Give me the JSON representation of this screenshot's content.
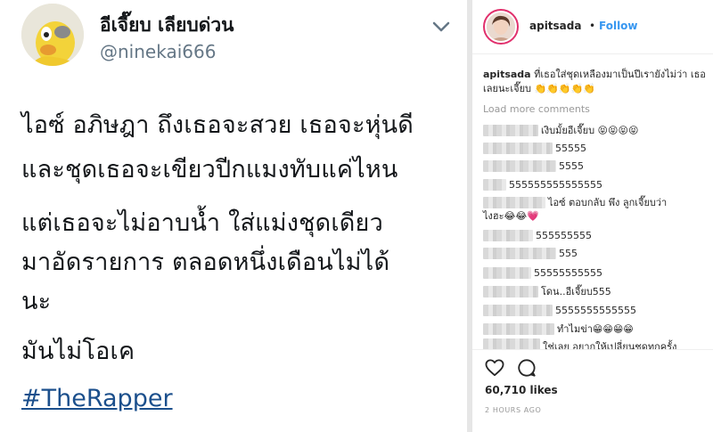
{
  "tweet": {
    "display_name": "อีเจี๊ยบ เลียบด่วน",
    "handle": "@ninekai666",
    "lines": [
      "ไอซ์ อภิษฎา ถึงเธอจะสวย เธอจะหุ่นดี",
      "และชุดเธอจะเขียวปีกแมงทับแค่ไหน",
      "แต่เธอจะไม่อาบน้ำ ใส่แม่งชุดเดียว",
      "มาอัดรายการ ตลอดหนึ่งเดือนไม่ได้",
      "นะ",
      "มันไม่โอเค"
    ],
    "hashtag": "#TheRapper",
    "caret_icon": "chevron-down-icon"
  },
  "instagram": {
    "username": "apitsada",
    "dot": "•",
    "follow_label": "Follow",
    "caption_user": "apitsada",
    "caption_text": "ที่เธอใส่ชุดเหลืองมาเป็นปีเรายังไม่ว่า เธอเลยนะเจี๊ยบ 👏👏👏👏👏",
    "load_more": "Load more comments",
    "comments": [
      {
        "text": "เงิบมั้ยอีเจี๊ยบ 😝😝😝😝"
      },
      {
        "text": "55555"
      },
      {
        "text": "5555"
      },
      {
        "text": "555555555555555"
      },
      {
        "text": "ไอซ์ ตอบกลับ พึง ลูกเจี๊ยบว่า"
      },
      {
        "text": "ไงฮะ😂😂💗"
      },
      {
        "text": "555555555"
      },
      {
        "text": "555"
      },
      {
        "text": "55555555555"
      },
      {
        "text": "โดน..อีเจี๊ยบ555"
      },
      {
        "text": "5555555555555"
      },
      {
        "text": "ทำไมข่า😁😁😁😁"
      },
      {
        "text": "ใช่เลย อยากให้เปลี่ยนชุดทุกครั้ง"
      }
    ],
    "likes": "60,710 likes",
    "time": "2 HOURS AGO",
    "accent_color": "#3897f0"
  }
}
